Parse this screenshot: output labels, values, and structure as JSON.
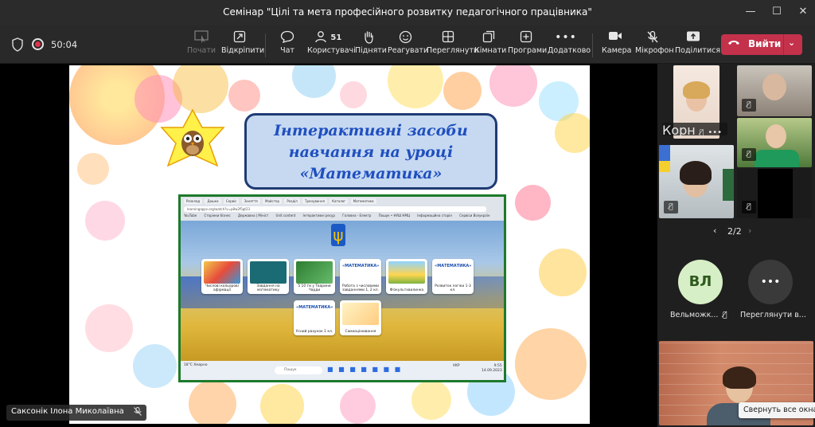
{
  "window": {
    "title": "Семінар \"Цілі та мета професійного розвитку педагогічного працівника\"",
    "minimize": "—",
    "maximize": "☐",
    "close": "✕"
  },
  "meeting": {
    "timer": "50:04"
  },
  "toolbar": {
    "buttons": [
      {
        "label": "Почати",
        "icon": "screen-pointer-icon"
      },
      {
        "label": "Відкріпити",
        "icon": "unpin-icon"
      },
      {
        "label": "Чат",
        "icon": "chat-icon"
      },
      {
        "label": "Користувачі",
        "icon": "people-icon",
        "count": "51"
      },
      {
        "label": "Підняти",
        "icon": "raise-hand-icon"
      },
      {
        "label": "Реагувати",
        "icon": "smile-icon"
      },
      {
        "label": "Переглянути",
        "icon": "view-icon"
      },
      {
        "label": "Кімнати",
        "icon": "rooms-icon"
      },
      {
        "label": "Програми",
        "icon": "apps-icon"
      },
      {
        "label": "Додатково",
        "icon": "more-icon"
      },
      {
        "label": "Камера",
        "icon": "camera-icon"
      },
      {
        "label": "Мікрофон",
        "icon": "mic-off-icon"
      },
      {
        "label": "Поділитися",
        "icon": "share-icon"
      }
    ],
    "leave_label": "Вийти"
  },
  "slide": {
    "title_lines": [
      "Інтерактивні засоби",
      "навчання на уроці",
      "«Математика»"
    ],
    "screenshot": {
      "tabs": [
        "Розклад",
        "Дошка",
        "Сервіс",
        "Заняття",
        "Майстер",
        "Розділ",
        "Тренування",
        "Каталог",
        "Математика"
      ],
      "url": "learningapps.org/watch?v=p8w2f5gt23",
      "bookmarks": [
        "YouTube",
        "Сторінки бізнес",
        "Державна | Мініст",
        "Unit content",
        "Інтерактивні ресур",
        "Головна - Електр",
        "Пошук • НУШ НМЦ",
        "Інформаційна сторін",
        "Сервіси Всеукраїн"
      ],
      "cards": [
        {
          "caption": "Числові кольорові афірмації"
        },
        {
          "caption": "Завдання на математику"
        },
        {
          "caption": "5 10 ти у Тварини Чарди"
        },
        {
          "caption": "Робота з числовими завданнями 1, 2 кл.",
          "mt": "«МАТЕМАТИКА»"
        },
        {
          "caption": "Фізкультхвилинка"
        },
        {
          "caption": "Розвиток логіки 1-3 кл.",
          "mt": "«МАТЕМАТИКА»"
        },
        {
          "caption": "Усний рахунок 1 кл.",
          "mt": "«МАТЕМАТИКА»"
        },
        {
          "caption": "Самооцінювання"
        }
      ],
      "taskbar": {
        "weather": "18°C Хмарно",
        "search": "Пошук",
        "lang": "УКР",
        "time": "9:55",
        "date": "14.09.2023"
      }
    }
  },
  "presenter": {
    "name": "Саксонік Ілона Миколаївна"
  },
  "participants": {
    "page": "2/2",
    "tiles": [
      {
        "name": "Корн"
      },
      {
        "name": ""
      },
      {
        "name": ""
      },
      {
        "name": ""
      },
      {
        "name": ""
      },
      {
        "name": ""
      }
    ],
    "avatars": [
      {
        "initials": "ВЛ",
        "name": "Вельможк...",
        "color": "#d7efc6"
      },
      {
        "initials": "•••",
        "name": "Переглянути в..."
      }
    ],
    "restore_label": "Свернуть все окна"
  }
}
